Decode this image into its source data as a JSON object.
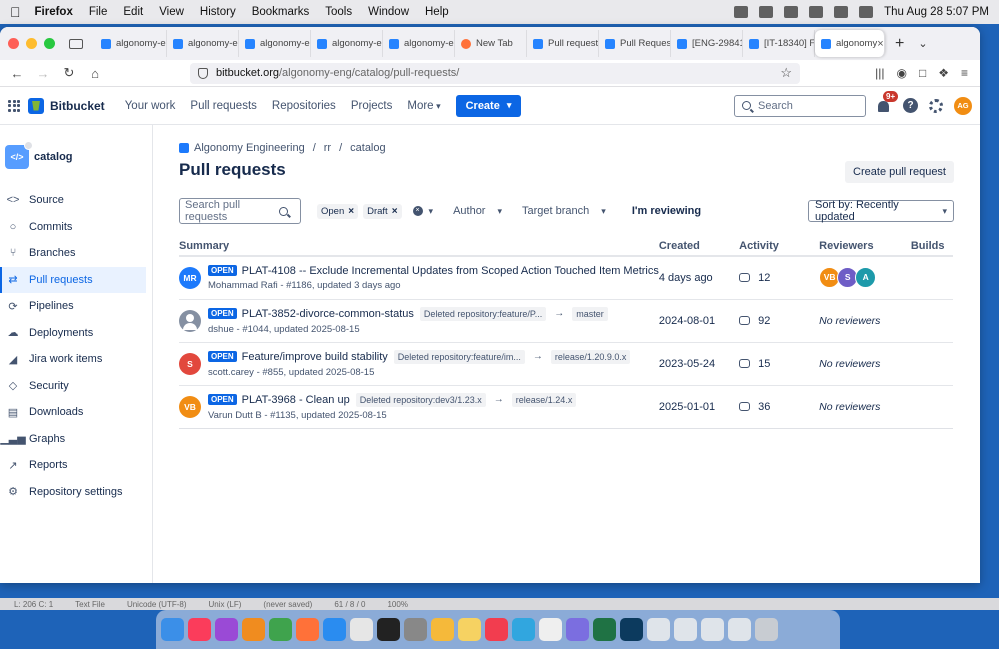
{
  "menubar": {
    "items": [
      "Firefox",
      "File",
      "Edit",
      "View",
      "History",
      "Bookmarks",
      "Tools",
      "Window",
      "Help"
    ],
    "clock": "Thu Aug 28  5:07 PM"
  },
  "browser": {
    "tabs": [
      {
        "label": "algonomy-en",
        "icon": "bitbucket"
      },
      {
        "label": "algonomy-en",
        "icon": "bitbucket"
      },
      {
        "label": "algonomy-en",
        "icon": "bitbucket"
      },
      {
        "label": "algonomy-en",
        "icon": "bitbucket"
      },
      {
        "label": "algonomy-en",
        "icon": "bitbucket"
      },
      {
        "label": "New Tab",
        "icon": "firefox"
      },
      {
        "label": "Pull requests",
        "icon": "bitbucket"
      },
      {
        "label": "Pull Request",
        "icon": "bitbucket"
      },
      {
        "label": "[ENG-29841",
        "icon": "jira"
      },
      {
        "label": "[IT-18340] F",
        "icon": "jira"
      },
      {
        "label": "algonomy",
        "icon": "bitbucket"
      }
    ],
    "url_domain": "bitbucket.org",
    "url_path": "/algonomy-eng/catalog/pull-requests/"
  },
  "topbar": {
    "product": "Bitbucket",
    "nav": [
      "Your work",
      "Pull requests",
      "Repositories",
      "Projects",
      "More"
    ],
    "create_label": "Create",
    "search_placeholder": "Search",
    "notif_badge": "9+",
    "help_label": "?",
    "user_initials": "AG"
  },
  "sidebar": {
    "repo_name": "catalog",
    "repo_icon_text": "</>",
    "items": [
      {
        "label": "Source",
        "icon": "code-icon",
        "glyph": "<>"
      },
      {
        "label": "Commits",
        "icon": "commit-icon",
        "glyph": "○"
      },
      {
        "label": "Branches",
        "icon": "branch-icon",
        "glyph": "⑂"
      },
      {
        "label": "Pull requests",
        "icon": "pull-request-icon",
        "glyph": "⇄"
      },
      {
        "label": "Pipelines",
        "icon": "pipeline-icon",
        "glyph": "⟳"
      },
      {
        "label": "Deployments",
        "icon": "cloud-icon",
        "glyph": "☁"
      },
      {
        "label": "Jira work items",
        "icon": "jira-icon",
        "glyph": "◢"
      },
      {
        "label": "Security",
        "icon": "shield-icon",
        "glyph": "◇"
      },
      {
        "label": "Downloads",
        "icon": "document-icon",
        "glyph": "▤"
      },
      {
        "label": "Graphs",
        "icon": "bar-chart-icon",
        "glyph": "▁▃▅"
      },
      {
        "label": "Reports",
        "icon": "report-icon",
        "glyph": "↗"
      },
      {
        "label": "Repository settings",
        "icon": "gear-icon",
        "glyph": "⚙"
      }
    ]
  },
  "main": {
    "breadcrumb": [
      "Algonomy Engineering",
      "rr",
      "catalog"
    ],
    "title": "Pull requests",
    "create_pr_label": "Create pull request",
    "search_placeholder": "Search pull requests",
    "chips": [
      "Open",
      "Draft"
    ],
    "author_label": "Author",
    "target_branch_label": "Target branch",
    "reviewing_label": "I'm reviewing",
    "sort_label": "Sort by: Recently updated",
    "columns": [
      "Summary",
      "Created",
      "Activity",
      "Reviewers",
      "Builds"
    ],
    "rows": [
      {
        "avatar": "MR",
        "avatar_color": "#1d7afc",
        "status": "OPEN",
        "title": "PLAT-4108 -- Exclude Incremental Updates from Scoped Action Touched Item Metrics",
        "source_branch": "",
        "target_branch": "",
        "meta": "Mohammad Rafi - #1186, updated 3 days ago",
        "created": "4 days ago",
        "activity": "12",
        "reviewers": [
          {
            "initials": "VB",
            "color": "#f18d13"
          },
          {
            "initials": "S",
            "color": "#6e5dc6"
          },
          {
            "initials": "A",
            "color": "#1d9aaa"
          }
        ],
        "no_reviewers": ""
      },
      {
        "avatar": "",
        "avatar_color": "#8590a2",
        "status": "OPEN",
        "title": "PLAT-3852-divorce-common-status",
        "source_branch": "Deleted repository:feature/P...",
        "target_branch": "master",
        "meta": "dshue - #1044, updated 2025-08-15",
        "created": "2024-08-01",
        "activity": "92",
        "reviewers": [],
        "no_reviewers": "No reviewers"
      },
      {
        "avatar": "S",
        "avatar_color": "#e2483d",
        "status": "OPEN",
        "title": "Feature/improve build stability",
        "source_branch": "Deleted repository:feature/im...",
        "target_branch": "release/1.20.9.0.x",
        "meta": "scott.carey - #855, updated 2025-08-15",
        "created": "2023-05-24",
        "activity": "15",
        "reviewers": [],
        "no_reviewers": "No reviewers"
      },
      {
        "avatar": "VB",
        "avatar_color": "#f18d13",
        "status": "OPEN",
        "title": "PLAT-3968 - Clean up",
        "source_branch": "Deleted repository:dev3/1.23.x",
        "target_branch": "release/1.24.x",
        "meta": "Varun Dutt B - #1135, updated 2025-08-15",
        "created": "2025-01-01",
        "activity": "36",
        "reviewers": [],
        "no_reviewers": "No reviewers"
      }
    ]
  },
  "statusbar": [
    "L: 206 C: 1",
    "Text File",
    "Unicode (UTF-8)",
    "Unix (LF)",
    "(never saved)",
    "61 / 8 / 0",
    "100%"
  ]
}
